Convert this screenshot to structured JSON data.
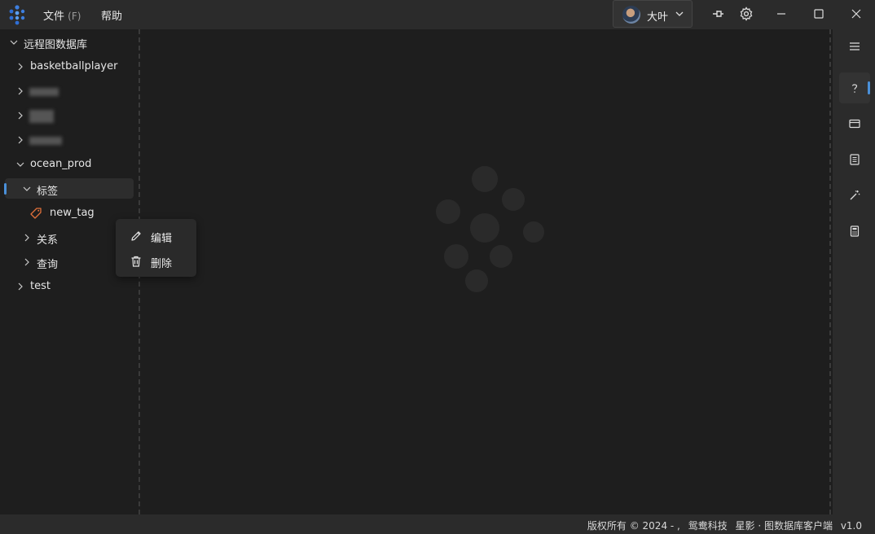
{
  "menu": {
    "file_label": "文件",
    "file_shortcut": "(F)",
    "help_label": "帮助"
  },
  "user": {
    "name": "大叶"
  },
  "tree": {
    "root": "远程图数据库",
    "db_basketball": "basketballplayer",
    "db_ocean": "ocean_prod",
    "tags_label": "标签",
    "tag_new": "new_tag",
    "edges_label": "关系",
    "query_label": "查询",
    "db_test": "test"
  },
  "context_menu": {
    "edit": "编辑",
    "delete": "删除"
  },
  "status": {
    "copyright": "版权所有 © 2024 - ,",
    "company": "鸳鸯科技",
    "product": "星影 · 图数据库客户端",
    "version": "v1.0"
  },
  "colors": {
    "accent": "#4a90d9",
    "tag_icon": "#e0703a",
    "logo": "#3d7fe0"
  }
}
